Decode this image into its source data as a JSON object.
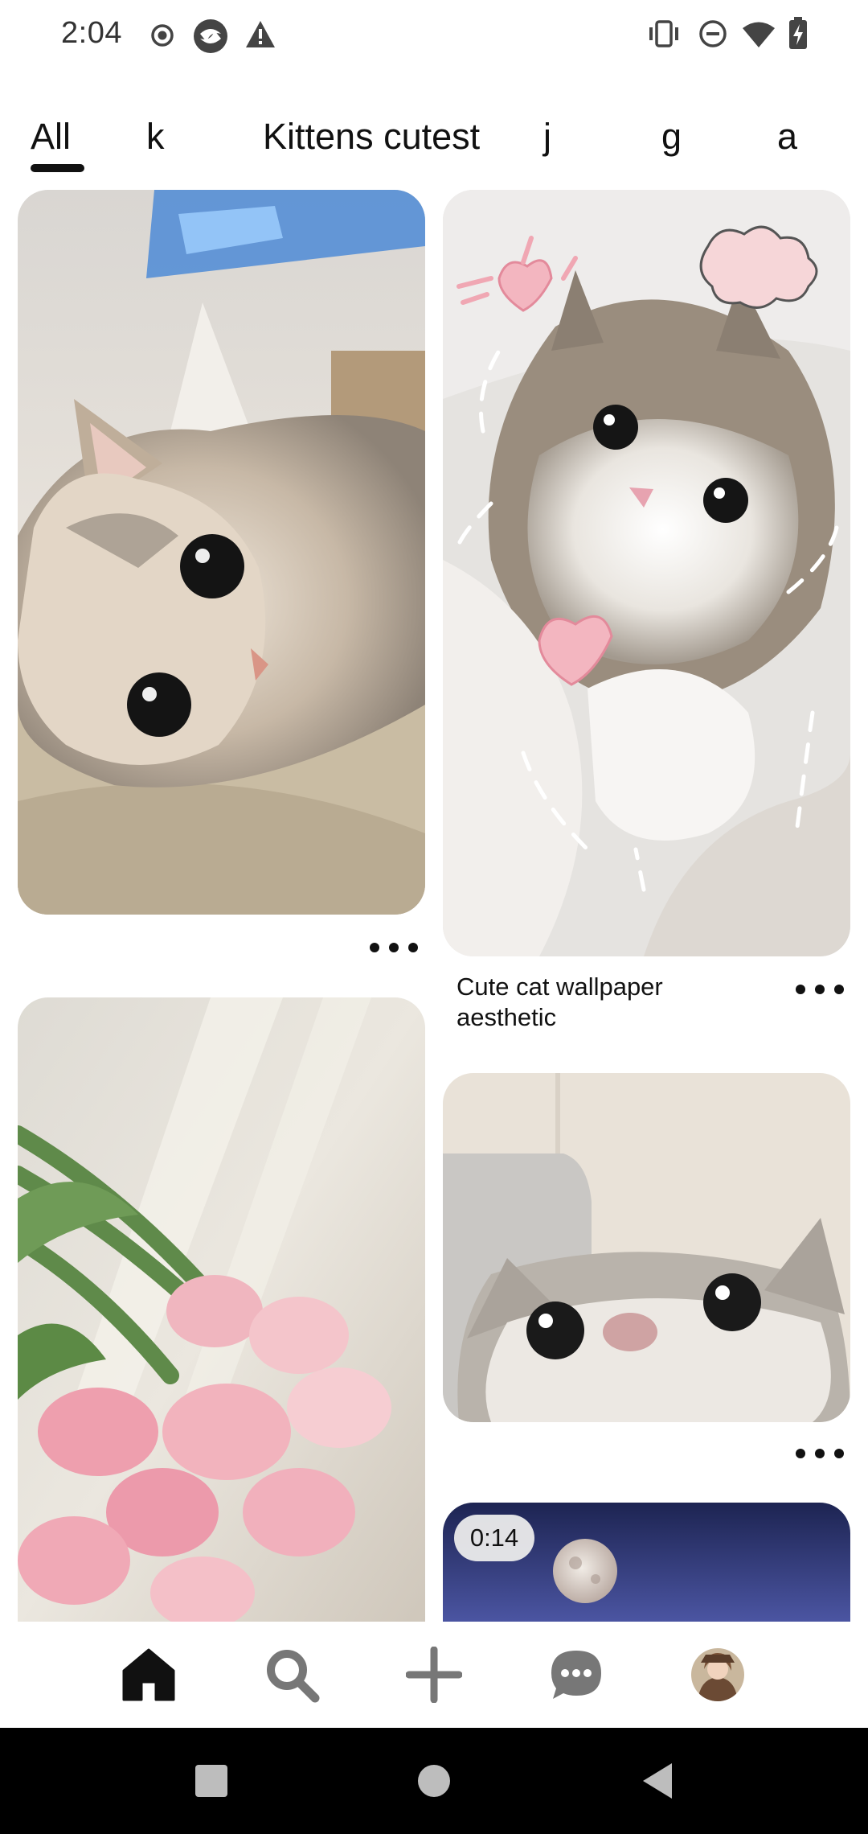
{
  "status_bar": {
    "time": "2:04",
    "left_icons": [
      "record-icon",
      "app-icon",
      "alert-icon"
    ],
    "right_icons": [
      "vibrate-icon",
      "do-not-disturb-icon",
      "wifi-icon",
      "battery-charging-icon"
    ]
  },
  "tabs": [
    {
      "label": "All",
      "selected": true
    },
    {
      "label": "k",
      "selected": false
    },
    {
      "label": "Kittens cutest",
      "selected": false
    },
    {
      "label": "j",
      "selected": false
    },
    {
      "label": "g",
      "selected": false
    },
    {
      "label": "a",
      "selected": false
    }
  ],
  "pins": {
    "pin1": {
      "image": "kitten lying on carpet"
    },
    "pin2": {
      "image": "kitten with doodle hearts",
      "title": "Cute cat wallpaper aesthetic"
    },
    "pin3": {
      "image": "pink tulips"
    },
    "pin4": {
      "image": "kitten peeking"
    },
    "pin5": {
      "image": "moon video",
      "duration": "0:14"
    }
  },
  "bottom_nav": {
    "items": [
      "home-icon",
      "search-icon",
      "create-icon",
      "messages-icon",
      "profile-avatar"
    ],
    "active": "home"
  },
  "system_nav": [
    "recents-icon",
    "home-icon",
    "back-icon"
  ],
  "colors": {
    "accent": "#111111",
    "background": "#ffffff"
  }
}
